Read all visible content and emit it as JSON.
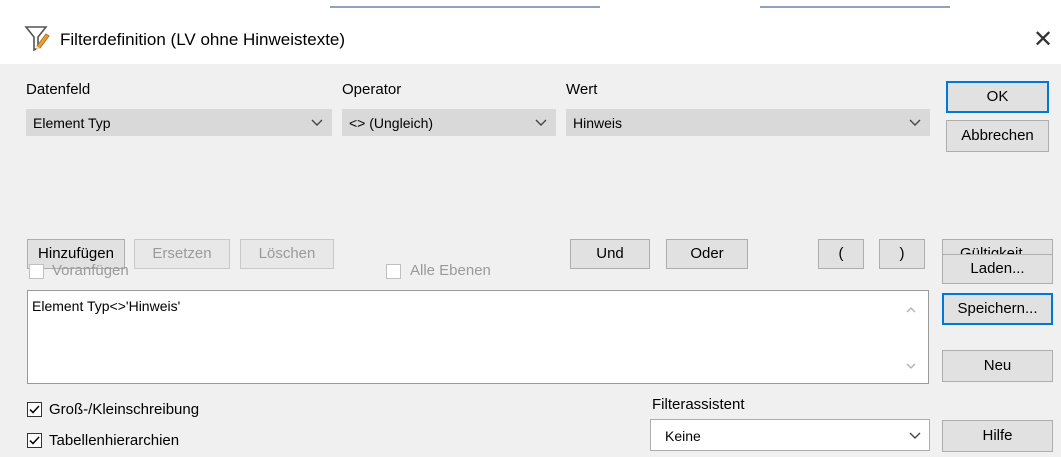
{
  "window": {
    "title": "Filterdefinition (LV ohne Hinweistexte)"
  },
  "icons": {
    "app": "filter-icon",
    "close": "close-icon",
    "dropdown": "chevron-down-icon"
  },
  "colors": {
    "client_bg": "#f0f0f0",
    "combo_bg": "#d9d9d9",
    "focus_border": "#0078d7"
  },
  "labels": {
    "datenfeld": "Datenfeld",
    "operator": "Operator",
    "wert": "Wert",
    "filterassistent": "Filterassistent"
  },
  "fields": {
    "datenfeld": "Element Typ",
    "operator": "<> (Ungleich)",
    "wert": "Hinweis",
    "filterassistent": "Keine"
  },
  "buttons": {
    "ok": "OK",
    "abbrechen": "Abbrechen",
    "hinzufuegen": "Hinzufügen",
    "ersetzen": "Ersetzen",
    "loeschen": "Löschen",
    "und": "Und",
    "oder": "Oder",
    "open_paren": "(",
    "close_paren": ")",
    "gueltigkeit": "Gültigkeit...",
    "laden": "Laden...",
    "speichern": "Speichern...",
    "neu": "Neu",
    "hilfe": "Hilfe"
  },
  "checkboxes": {
    "voranfuegen": {
      "label": "Voranfügen",
      "checked": false,
      "enabled": false
    },
    "alle_ebenen": {
      "label": "Alle Ebenen",
      "checked": false,
      "enabled": false
    },
    "gross_klein": {
      "label": "Groß-/Kleinschreibung",
      "checked": true,
      "enabled": true
    },
    "tabellenhierarchien": {
      "label": "Tabellenhierarchien",
      "checked": true,
      "enabled": true
    }
  },
  "expression": "Element Typ<>'Hinweis'"
}
